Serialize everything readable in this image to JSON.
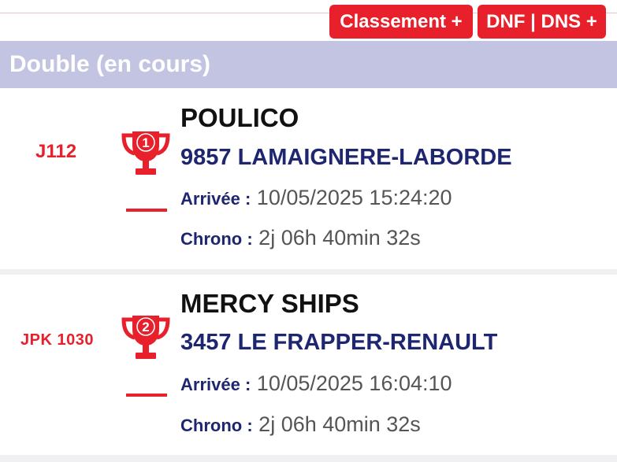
{
  "buttons": {
    "classement": "Classement +",
    "dnf_dns": "DNF | DNS +"
  },
  "section": {
    "title": "Double (en cours)"
  },
  "labels": {
    "arrivee": "Arrivée :",
    "chrono": "Chrono :"
  },
  "colors": {
    "accent_red": "#e8202b",
    "header_bg": "#c2c4e1",
    "crew_navy": "#1f2670"
  },
  "entries": [
    {
      "rank": "1",
      "sail_number": "J112",
      "boat_name": "POULICO",
      "crew": "9857 LAMAIGNERE-LABORDE",
      "arrivee": "10/05/2025 15:24:20",
      "chrono": "2j 06h 40min 32s",
      "icon": "trophy-icon"
    },
    {
      "rank": "2",
      "sail_number": "JPK 1030",
      "boat_name": "MERCY SHIPS",
      "crew": "3457 LE FRAPPER-RENAULT",
      "arrivee": "10/05/2025 16:04:10",
      "chrono": "2j 06h 40min 32s",
      "icon": "trophy-icon"
    }
  ]
}
